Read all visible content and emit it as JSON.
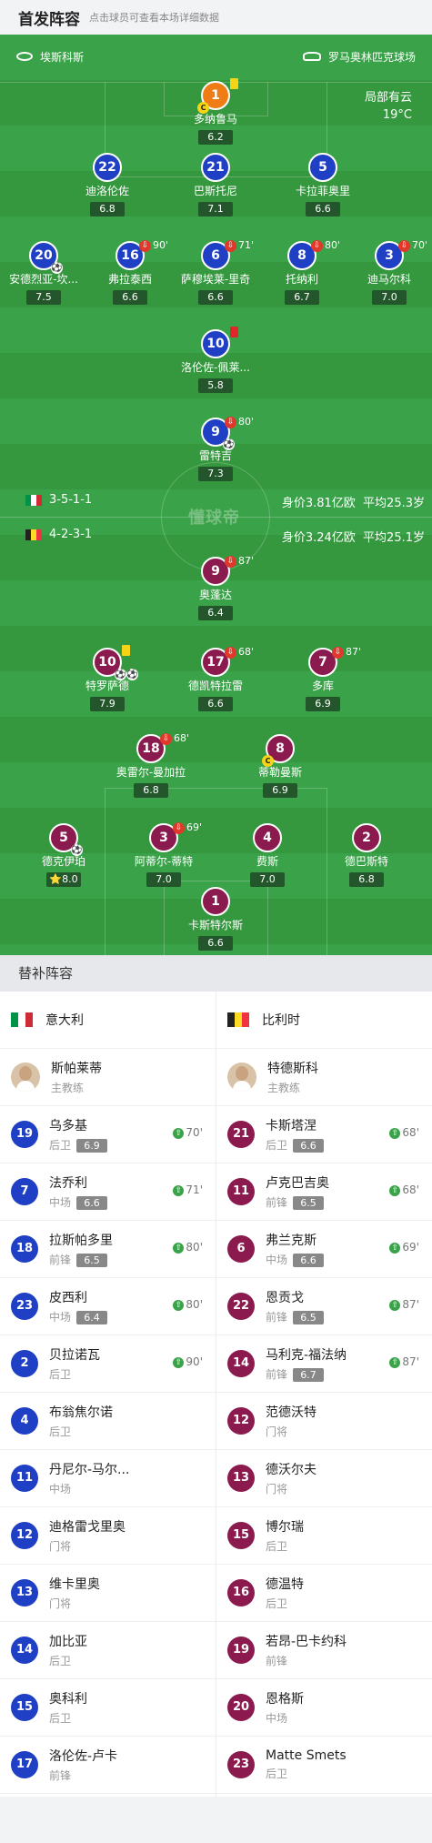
{
  "header": {
    "title": "首发阵容",
    "subtitle": "点击球员可查看本场详细数据"
  },
  "match": {
    "home_team": "埃斯科斯",
    "venue": "罗马奥林匹克球场",
    "weather": "局部有云",
    "temp": "19°C"
  },
  "formations": {
    "home": {
      "formation": "3-5-1-1",
      "value": "身价3.81亿欧",
      "age": "平均25.3岁"
    },
    "away": {
      "formation": "4-2-3-1",
      "value": "身价3.24亿欧",
      "age": "平均25.1岁"
    }
  },
  "watermark": "懂球帝",
  "home_players": [
    {
      "num": "1",
      "name": "多纳鲁马",
      "rating": "6.2",
      "yellow": true,
      "captain": true,
      "gk": true
    },
    {
      "num": "22",
      "name": "迪洛伦佐",
      "rating": "6.8"
    },
    {
      "num": "21",
      "name": "巴斯托尼",
      "rating": "7.1"
    },
    {
      "num": "5",
      "name": "卡拉菲奥里",
      "rating": "6.6"
    },
    {
      "num": "20",
      "name": "安德烈亚-坎...",
      "rating": "7.5",
      "goal": true
    },
    {
      "num": "16",
      "name": "弗拉泰西",
      "rating": "6.6",
      "sub": "90'"
    },
    {
      "num": "6",
      "name": "萨穆埃莱-里奇",
      "rating": "6.6",
      "sub": "71'"
    },
    {
      "num": "8",
      "name": "托纳利",
      "rating": "6.7",
      "sub": "80'"
    },
    {
      "num": "3",
      "name": "迪马尔科",
      "rating": "7.0",
      "sub": "70'"
    },
    {
      "num": "10",
      "name": "洛伦佐-佩莱...",
      "rating": "5.8",
      "red": true
    },
    {
      "num": "9",
      "name": "雷特吉",
      "rating": "7.3",
      "sub": "80'",
      "goal": true
    }
  ],
  "away_players": [
    {
      "num": "9",
      "name": "奥蓬达",
      "rating": "6.4",
      "sub": "87'"
    },
    {
      "num": "10",
      "name": "特罗萨德",
      "rating": "7.9",
      "yellow": true,
      "goal": true,
      "goal2": true
    },
    {
      "num": "17",
      "name": "德凯特拉雷",
      "rating": "6.6",
      "sub": "68'"
    },
    {
      "num": "7",
      "name": "多库",
      "rating": "6.9",
      "sub": "87'"
    },
    {
      "num": "18",
      "name": "奥雷尔-曼加拉",
      "rating": "6.8",
      "sub": "68'"
    },
    {
      "num": "8",
      "name": "蒂勒曼斯",
      "rating": "6.9",
      "captain": true
    },
    {
      "num": "5",
      "name": "德克伊珀",
      "rating": "⭐8.0",
      "goal": true
    },
    {
      "num": "3",
      "name": "阿蒂尔-蒂特",
      "rating": "7.0",
      "sub": "69'"
    },
    {
      "num": "4",
      "name": "费斯",
      "rating": "7.0"
    },
    {
      "num": "2",
      "name": "德巴斯特",
      "rating": "6.8"
    },
    {
      "num": "1",
      "name": "卡斯特尔斯",
      "rating": "6.6",
      "gk": true
    }
  ],
  "subs_title": "替补阵容",
  "home_bench": {
    "team": "意大利",
    "coach": {
      "name": "斯帕莱蒂",
      "role": "主教练"
    },
    "players": [
      {
        "num": "19",
        "name": "乌多基",
        "pos": "后卫",
        "rating": "6.9",
        "min": "70'"
      },
      {
        "num": "7",
        "name": "法乔利",
        "pos": "中场",
        "rating": "6.6",
        "min": "71'"
      },
      {
        "num": "18",
        "name": "拉斯帕多里",
        "pos": "前锋",
        "rating": "6.5",
        "min": "80'"
      },
      {
        "num": "23",
        "name": "皮西利",
        "pos": "中场",
        "rating": "6.4",
        "min": "80'"
      },
      {
        "num": "2",
        "name": "贝拉诺瓦",
        "pos": "后卫",
        "rating": "",
        "min": "90'"
      },
      {
        "num": "4",
        "name": "布翁焦尔诺",
        "pos": "后卫",
        "rating": "",
        "min": ""
      },
      {
        "num": "11",
        "name": "丹尼尔-马尔...",
        "pos": "中场",
        "rating": "",
        "min": ""
      },
      {
        "num": "12",
        "name": "迪格雷戈里奥",
        "pos": "门将",
        "rating": "",
        "min": ""
      },
      {
        "num": "13",
        "name": "维卡里奥",
        "pos": "门将",
        "rating": "",
        "min": ""
      },
      {
        "num": "14",
        "name": "加比亚",
        "pos": "后卫",
        "rating": "",
        "min": ""
      },
      {
        "num": "15",
        "name": "奥科利",
        "pos": "后卫",
        "rating": "",
        "min": ""
      },
      {
        "num": "17",
        "name": "洛伦佐-卢卡",
        "pos": "前锋",
        "rating": "",
        "min": ""
      }
    ]
  },
  "away_bench": {
    "team": "比利时",
    "coach": {
      "name": "特德斯科",
      "role": "主教练"
    },
    "players": [
      {
        "num": "21",
        "name": "卡斯塔涅",
        "pos": "后卫",
        "rating": "6.6",
        "min": "68'"
      },
      {
        "num": "11",
        "name": "卢克巴吉奥",
        "pos": "前锋",
        "rating": "6.5",
        "min": "68'"
      },
      {
        "num": "6",
        "name": "弗兰克斯",
        "pos": "中场",
        "rating": "6.6",
        "min": "69'"
      },
      {
        "num": "22",
        "name": "恩贡戈",
        "pos": "前锋",
        "rating": "6.5",
        "min": "87'"
      },
      {
        "num": "14",
        "name": "马利克-福法纳",
        "pos": "前锋",
        "rating": "6.7",
        "min": "87'"
      },
      {
        "num": "12",
        "name": "范德沃特",
        "pos": "门将",
        "rating": "",
        "min": ""
      },
      {
        "num": "13",
        "name": "德沃尔夫",
        "pos": "门将",
        "rating": "",
        "min": ""
      },
      {
        "num": "15",
        "name": "博尔瑞",
        "pos": "后卫",
        "rating": "",
        "min": ""
      },
      {
        "num": "16",
        "name": "德温特",
        "pos": "后卫",
        "rating": "",
        "min": ""
      },
      {
        "num": "19",
        "name": "若昂-巴卡约科",
        "pos": "前锋",
        "rating": "",
        "min": ""
      },
      {
        "num": "20",
        "name": "恩格斯",
        "pos": "中场",
        "rating": "",
        "min": ""
      },
      {
        "num": "23",
        "name": "Matte Smets",
        "pos": "后卫",
        "rating": "",
        "min": ""
      }
    ]
  }
}
